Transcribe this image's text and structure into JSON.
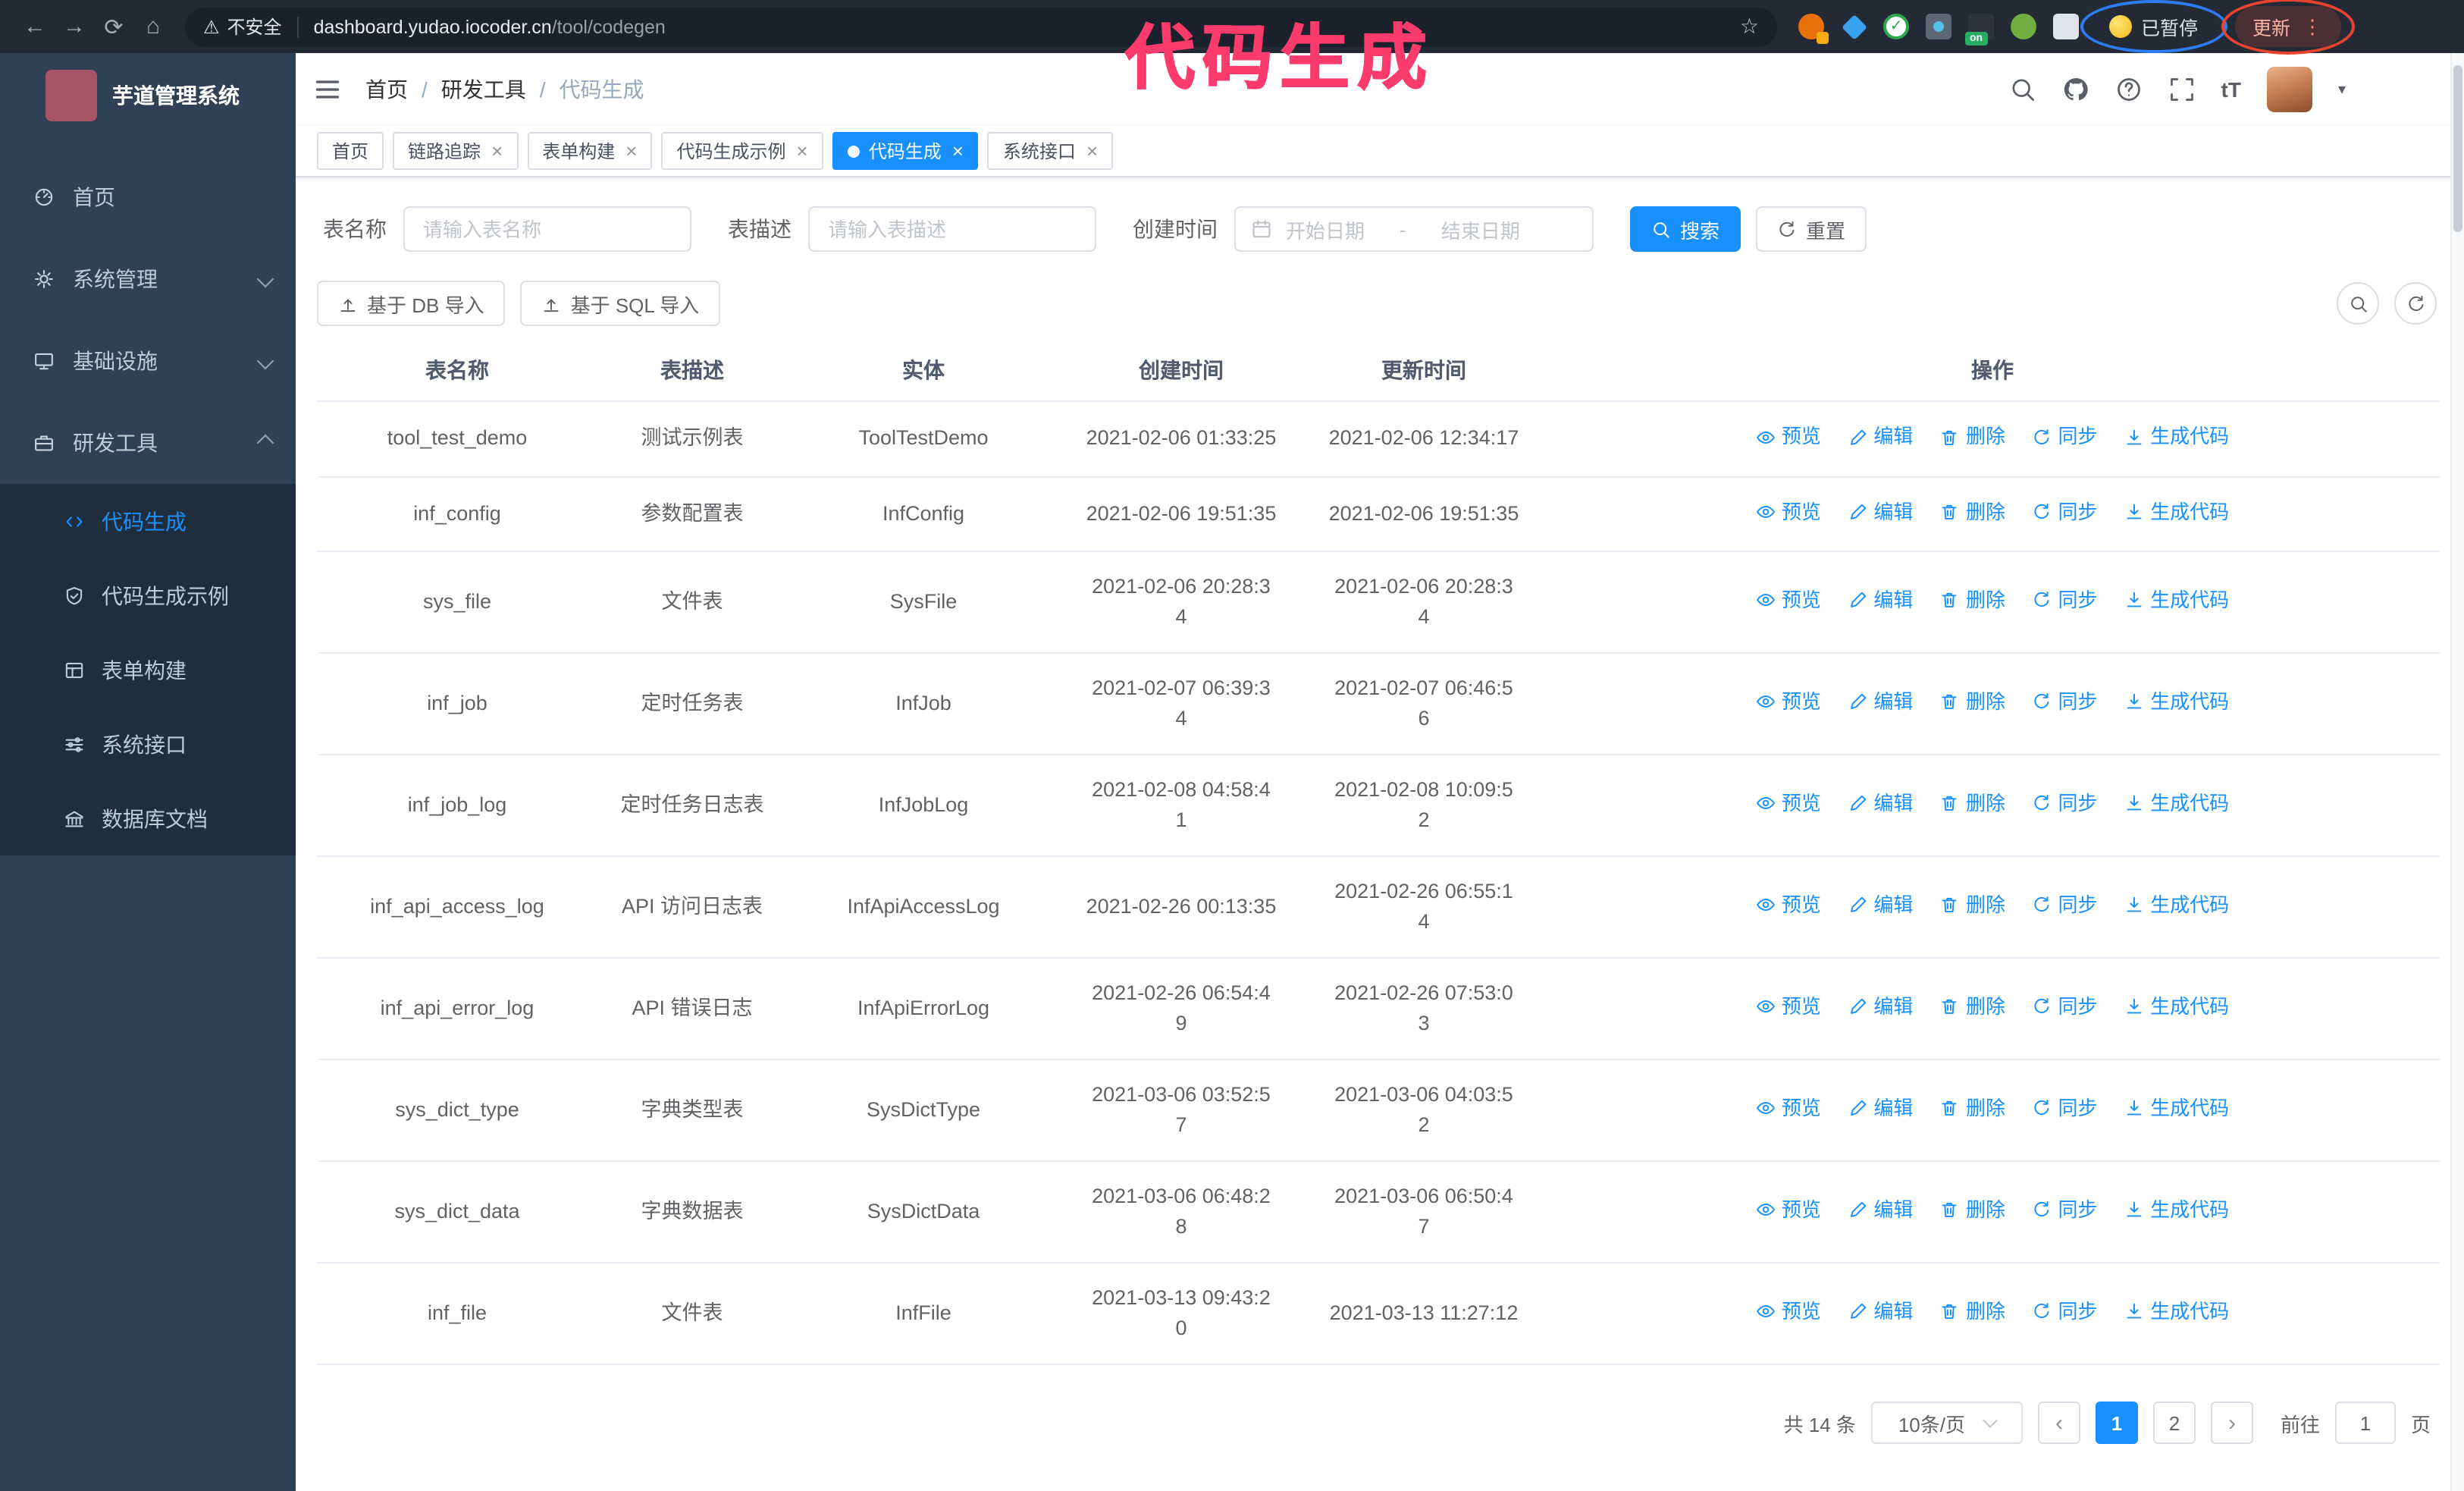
{
  "annotation": {
    "text": "代码生成"
  },
  "browser": {
    "security": "不安全",
    "host": "dashboard.yudao.iocoder.cn",
    "path": "/tool/codegen",
    "paused": "已暂停",
    "update": "更新",
    "ext_badge": "on"
  },
  "sidebar": {
    "title": "芋道管理系统",
    "items": [
      {
        "label": "首页"
      },
      {
        "label": "系统管理"
      },
      {
        "label": "基础设施"
      },
      {
        "label": "研发工具"
      }
    ],
    "submenu": [
      {
        "label": "代码生成"
      },
      {
        "label": "代码生成示例"
      },
      {
        "label": "表单构建"
      },
      {
        "label": "系统接口"
      },
      {
        "label": "数据库文档"
      }
    ]
  },
  "header": {
    "breadcrumb": [
      "首页",
      "研发工具",
      "代码生成"
    ],
    "font_size_label": "tT"
  },
  "tabs": [
    {
      "label": "首页"
    },
    {
      "label": "链路追踪"
    },
    {
      "label": "表单构建"
    },
    {
      "label": "代码生成示例"
    },
    {
      "label": "代码生成"
    },
    {
      "label": "系统接口"
    }
  ],
  "filters": {
    "name_label": "表名称",
    "name_placeholder": "请输入表名称",
    "desc_label": "表描述",
    "desc_placeholder": "请输入表描述",
    "time_label": "创建时间",
    "start_placeholder": "开始日期",
    "range_separator": "-",
    "end_placeholder": "结束日期",
    "search": "搜索",
    "reset": "重置"
  },
  "toolbar": {
    "db_import": "基于 DB 导入",
    "sql_import": "基于 SQL 导入"
  },
  "table": {
    "columns": [
      "表名称",
      "表描述",
      "实体",
      "创建时间",
      "更新时间",
      "操作"
    ],
    "ops": [
      "预览",
      "编辑",
      "删除",
      "同步",
      "生成代码"
    ],
    "rows": [
      {
        "name": "tool_test_demo",
        "desc": "测试示例表",
        "entity": "ToolTestDemo",
        "created": "2021-02-06 01:33:25",
        "updated": "2021-02-06 12:34:17"
      },
      {
        "name": "inf_config",
        "desc": "参数配置表",
        "entity": "InfConfig",
        "created": "2021-02-06 19:51:35",
        "updated": "2021-02-06 19:51:35"
      },
      {
        "name": "sys_file",
        "desc": "文件表",
        "entity": "SysFile",
        "created": "2021-02-06 20:28:3\n4",
        "updated": "2021-02-06 20:28:3\n4"
      },
      {
        "name": "inf_job",
        "desc": "定时任务表",
        "entity": "InfJob",
        "created": "2021-02-07 06:39:3\n4",
        "updated": "2021-02-07 06:46:5\n6"
      },
      {
        "name": "inf_job_log",
        "desc": "定时任务日志表",
        "entity": "InfJobLog",
        "created": "2021-02-08 04:58:4\n1",
        "updated": "2021-02-08 10:09:5\n2"
      },
      {
        "name": "inf_api_access_log",
        "desc": "API 访问日志表",
        "entity": "InfApiAccessLog",
        "created": "2021-02-26 00:13:35",
        "updated": "2021-02-26 06:55:1\n4"
      },
      {
        "name": "inf_api_error_log",
        "desc": "API 错误日志",
        "entity": "InfApiErrorLog",
        "created": "2021-02-26 06:54:4\n9",
        "updated": "2021-02-26 07:53:0\n3"
      },
      {
        "name": "sys_dict_type",
        "desc": "字典类型表",
        "entity": "SysDictType",
        "created": "2021-03-06 03:52:5\n7",
        "updated": "2021-03-06 04:03:5\n2"
      },
      {
        "name": "sys_dict_data",
        "desc": "字典数据表",
        "entity": "SysDictData",
        "created": "2021-03-06 06:48:2\n8",
        "updated": "2021-03-06 06:50:4\n7"
      },
      {
        "name": "inf_file",
        "desc": "文件表",
        "entity": "InfFile",
        "created": "2021-03-13 09:43:2\n0",
        "updated": "2021-03-13 11:27:12"
      }
    ]
  },
  "pagination": {
    "total": "共 14 条",
    "page_size": "10条/页",
    "pages": [
      "1",
      "2"
    ],
    "goto": "前往",
    "goto_value": "1",
    "unit": "页"
  },
  "colors": {
    "accent": "#1890ff",
    "sidebar": "#304156",
    "submenu": "#1f2d3d",
    "annotation": "#fb3b6b"
  }
}
